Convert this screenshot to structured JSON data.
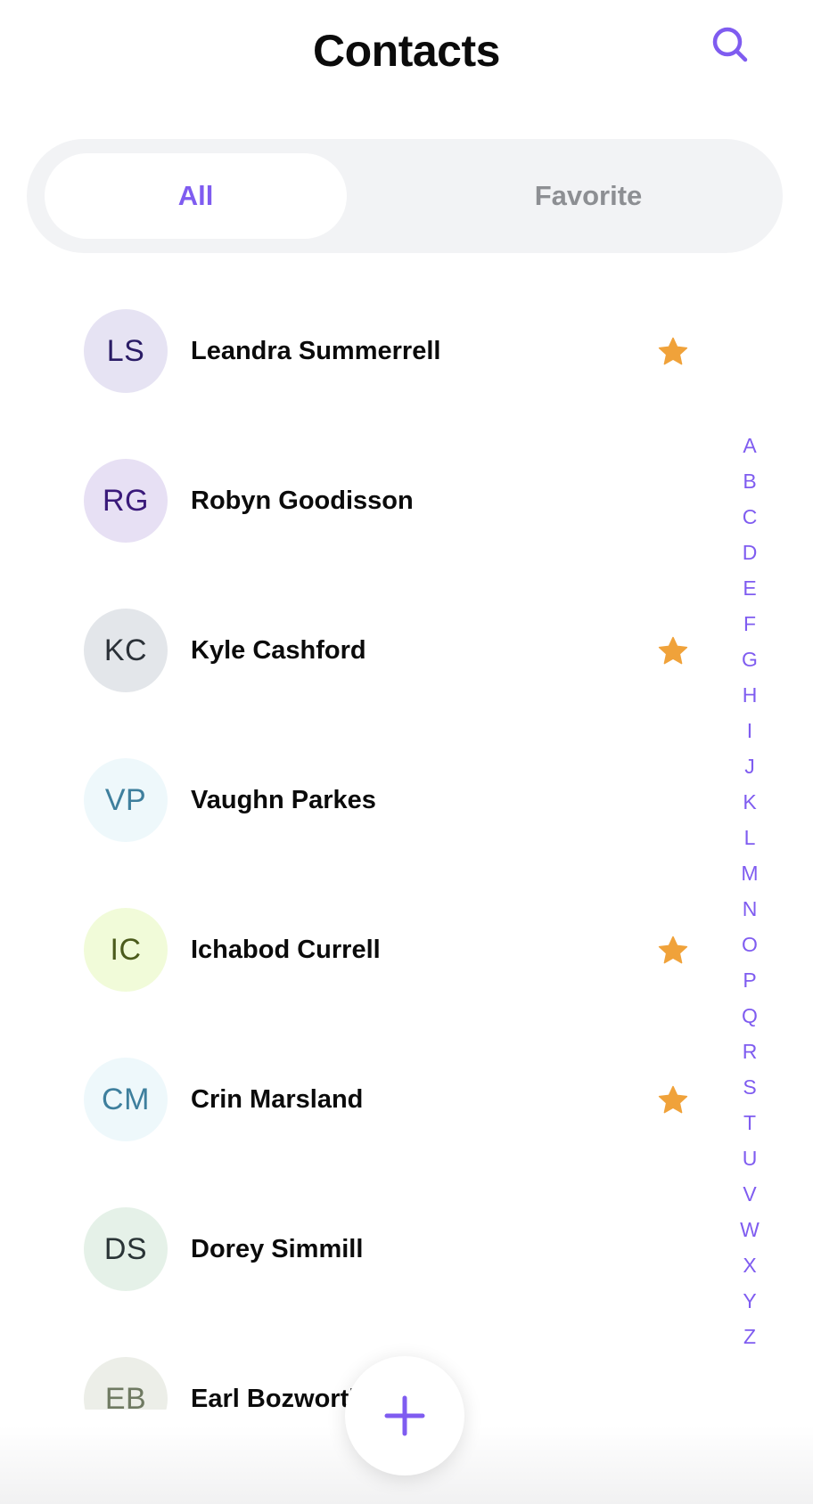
{
  "header": {
    "title": "Contacts",
    "search_icon": "search-icon"
  },
  "tabs": [
    {
      "label": "All",
      "active": true
    },
    {
      "label": "Favorite",
      "active": false
    }
  ],
  "contacts": [
    {
      "initials": "LS",
      "name": "Leandra Summerrell",
      "favorite": true,
      "avatar_bg": "#e6e3f3",
      "avatar_fg": "#2a1c66"
    },
    {
      "initials": "RG",
      "name": "Robyn Goodisson",
      "favorite": false,
      "avatar_bg": "#e7e0f4",
      "avatar_fg": "#3a1a7a"
    },
    {
      "initials": "KC",
      "name": "Kyle Cashford",
      "favorite": true,
      "avatar_bg": "#e3e6ea",
      "avatar_fg": "#2b3138"
    },
    {
      "initials": "VP",
      "name": "Vaughn Parkes",
      "favorite": false,
      "avatar_bg": "#eef8fb",
      "avatar_fg": "#3e7f9d"
    },
    {
      "initials": "IC",
      "name": "Ichabod Currell",
      "favorite": true,
      "avatar_bg": "#f1fbd9",
      "avatar_fg": "#4b5b1c"
    },
    {
      "initials": "CM",
      "name": "Crin Marsland",
      "favorite": true,
      "avatar_bg": "#eef8fb",
      "avatar_fg": "#3e7f9d"
    },
    {
      "initials": "DS",
      "name": "Dorey Simmill",
      "favorite": false,
      "avatar_bg": "#e5f1e8",
      "avatar_fg": "#2a3436"
    },
    {
      "initials": "EB",
      "name": "Earl Bozworth",
      "favorite": false,
      "avatar_bg": "#eceee8",
      "avatar_fg": "#6f7a62"
    }
  ],
  "alphabet": [
    "A",
    "B",
    "C",
    "D",
    "E",
    "F",
    "G",
    "H",
    "I",
    "J",
    "K",
    "L",
    "M",
    "N",
    "O",
    "P",
    "Q",
    "R",
    "S",
    "T",
    "U",
    "V",
    "W",
    "X",
    "Y",
    "Z"
  ],
  "fab": {
    "icon": "plus-icon"
  },
  "colors": {
    "accent": "#7f5cf0",
    "star": "#f0a23a",
    "segment_bg": "#f2f3f5",
    "inactive_tab": "#8d8f93"
  }
}
